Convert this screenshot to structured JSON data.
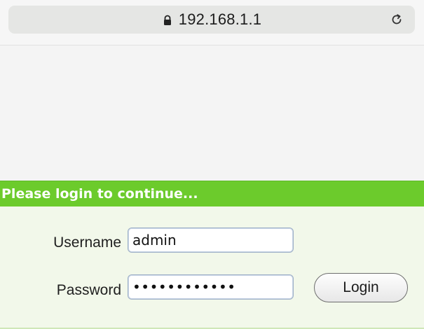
{
  "browser": {
    "url": "192.168.1.1",
    "lock_icon": "lock-icon",
    "reload_icon": "reload-icon"
  },
  "login": {
    "banner": "Please login to continue...",
    "username_label": "Username",
    "username_value": "admin",
    "password_label": "Password",
    "password_value": "************",
    "login_button": "Login"
  },
  "colors": {
    "banner_bg": "#6ccb2c",
    "form_bg": "#f2f8ea"
  }
}
